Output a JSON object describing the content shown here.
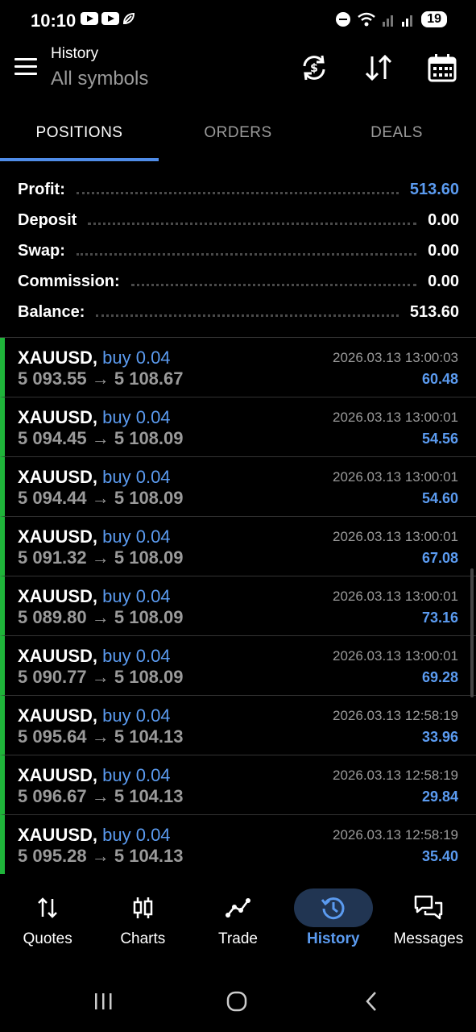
{
  "status": {
    "time": "10:10",
    "battery": "19"
  },
  "header": {
    "title": "History",
    "subtitle": "All symbols"
  },
  "tabs": [
    "POSITIONS",
    "ORDERS",
    "DEALS"
  ],
  "summary": [
    {
      "label": "Profit:",
      "value": "513.60"
    },
    {
      "label": "Deposit",
      "value": "0.00"
    },
    {
      "label": "Swap:",
      "value": "0.00"
    },
    {
      "label": "Commission:",
      "value": "0.00"
    },
    {
      "label": "Balance:",
      "value": "513.60"
    }
  ],
  "positions": [
    {
      "symbol": "XAUUSD,",
      "side": "buy 0.04",
      "prices": "5 093.55 → 5 108.67",
      "time": "2026.03.13 13:00:03",
      "profit": "60.48"
    },
    {
      "symbol": "XAUUSD,",
      "side": "buy 0.04",
      "prices": "5 094.45 → 5 108.09",
      "time": "2026.03.13 13:00:01",
      "profit": "54.56"
    },
    {
      "symbol": "XAUUSD,",
      "side": "buy 0.04",
      "prices": "5 094.44 → 5 108.09",
      "time": "2026.03.13 13:00:01",
      "profit": "54.60"
    },
    {
      "symbol": "XAUUSD,",
      "side": "buy 0.04",
      "prices": "5 091.32 → 5 108.09",
      "time": "2026.03.13 13:00:01",
      "profit": "67.08"
    },
    {
      "symbol": "XAUUSD,",
      "side": "buy 0.04",
      "prices": "5 089.80 → 5 108.09",
      "time": "2026.03.13 13:00:01",
      "profit": "73.16"
    },
    {
      "symbol": "XAUUSD,",
      "side": "buy 0.04",
      "prices": "5 090.77 → 5 108.09",
      "time": "2026.03.13 13:00:01",
      "profit": "69.28"
    },
    {
      "symbol": "XAUUSD,",
      "side": "buy 0.04",
      "prices": "5 095.64 → 5 104.13",
      "time": "2026.03.13 12:58:19",
      "profit": "33.96"
    },
    {
      "symbol": "XAUUSD,",
      "side": "buy 0.04",
      "prices": "5 096.67 → 5 104.13",
      "time": "2026.03.13 12:58:19",
      "profit": "29.84"
    },
    {
      "symbol": "XAUUSD,",
      "side": "buy 0.04",
      "prices": "5 095.28 → 5 104.13",
      "time": "2026.03.13 12:58:19",
      "profit": "35.40"
    }
  ],
  "bottom_nav": [
    {
      "label": "Quotes",
      "icon": "quotes-icon"
    },
    {
      "label": "Charts",
      "icon": "candlestick-icon"
    },
    {
      "label": "Trade",
      "icon": "trend-icon"
    },
    {
      "label": "History",
      "icon": "history-icon"
    },
    {
      "label": "Messages",
      "icon": "messages-icon"
    }
  ],
  "colors": {
    "accent": "#5b9bf0",
    "profit_bar": "#1fb53a",
    "background": "#000000"
  }
}
